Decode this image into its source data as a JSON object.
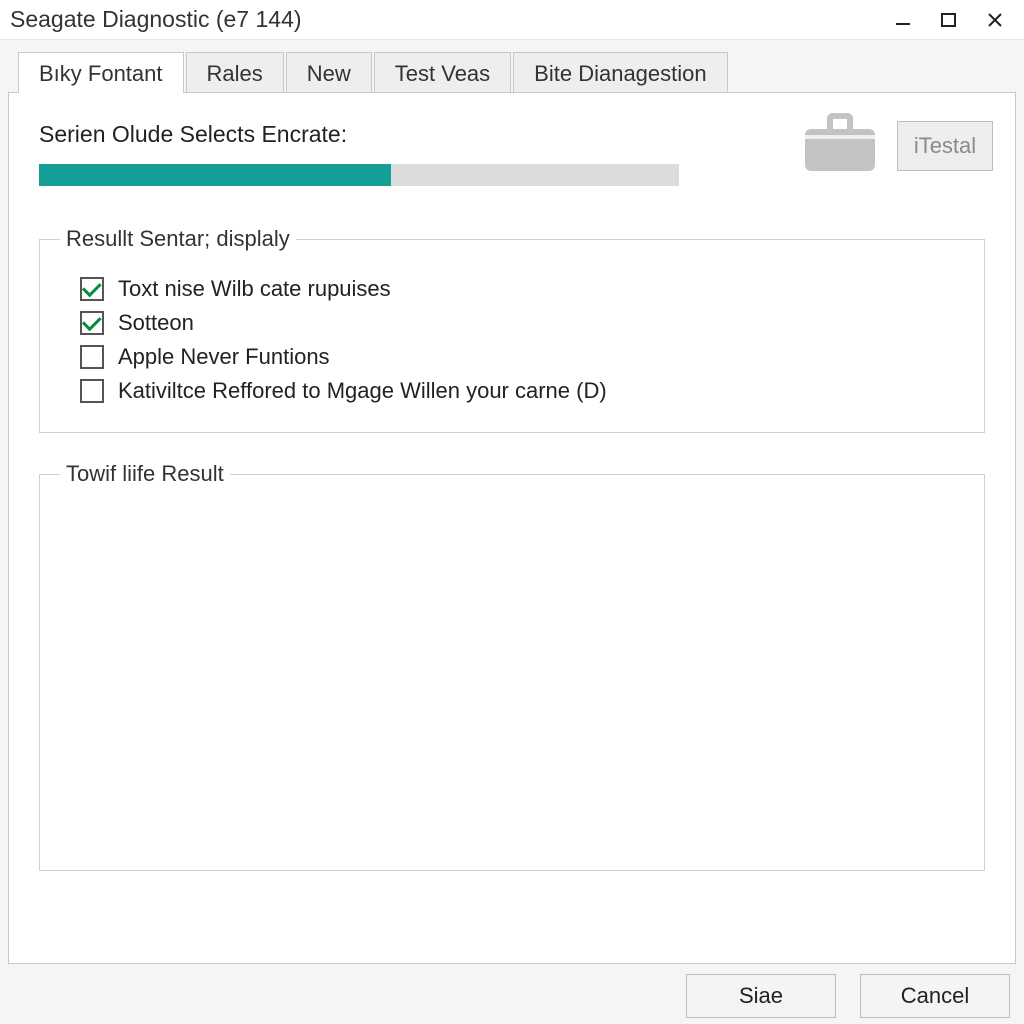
{
  "window": {
    "title": "Seagate Diagnostic (e7 144)"
  },
  "tabs": [
    {
      "label": "Bıky Fontant",
      "active": true
    },
    {
      "label": "Rales",
      "active": false
    },
    {
      "label": "New",
      "active": false
    },
    {
      "label": "Test Veas",
      "active": false
    },
    {
      "label": "Bite Dianagestion",
      "active": false
    }
  ],
  "main": {
    "progress_label": "Serien Olude Selects Encrate:",
    "progress_pct": 55,
    "testal_button": "iTestal",
    "options_group_title": "Resullt Sentar; displaly",
    "options": [
      {
        "label": "Toxt nise Wilb cate rupuises",
        "checked": true
      },
      {
        "label": "Sotteon",
        "checked": true
      },
      {
        "label": "Apple Never Funtions",
        "checked": false
      },
      {
        "label": "Kativiltce Reffored to Mgage Willen your carne (D)",
        "checked": false
      }
    ],
    "result_group_title": "Towif liife Result"
  },
  "footer": {
    "primary": "Siae",
    "cancel": "Cancel"
  },
  "colors": {
    "accent": "#149e96"
  }
}
